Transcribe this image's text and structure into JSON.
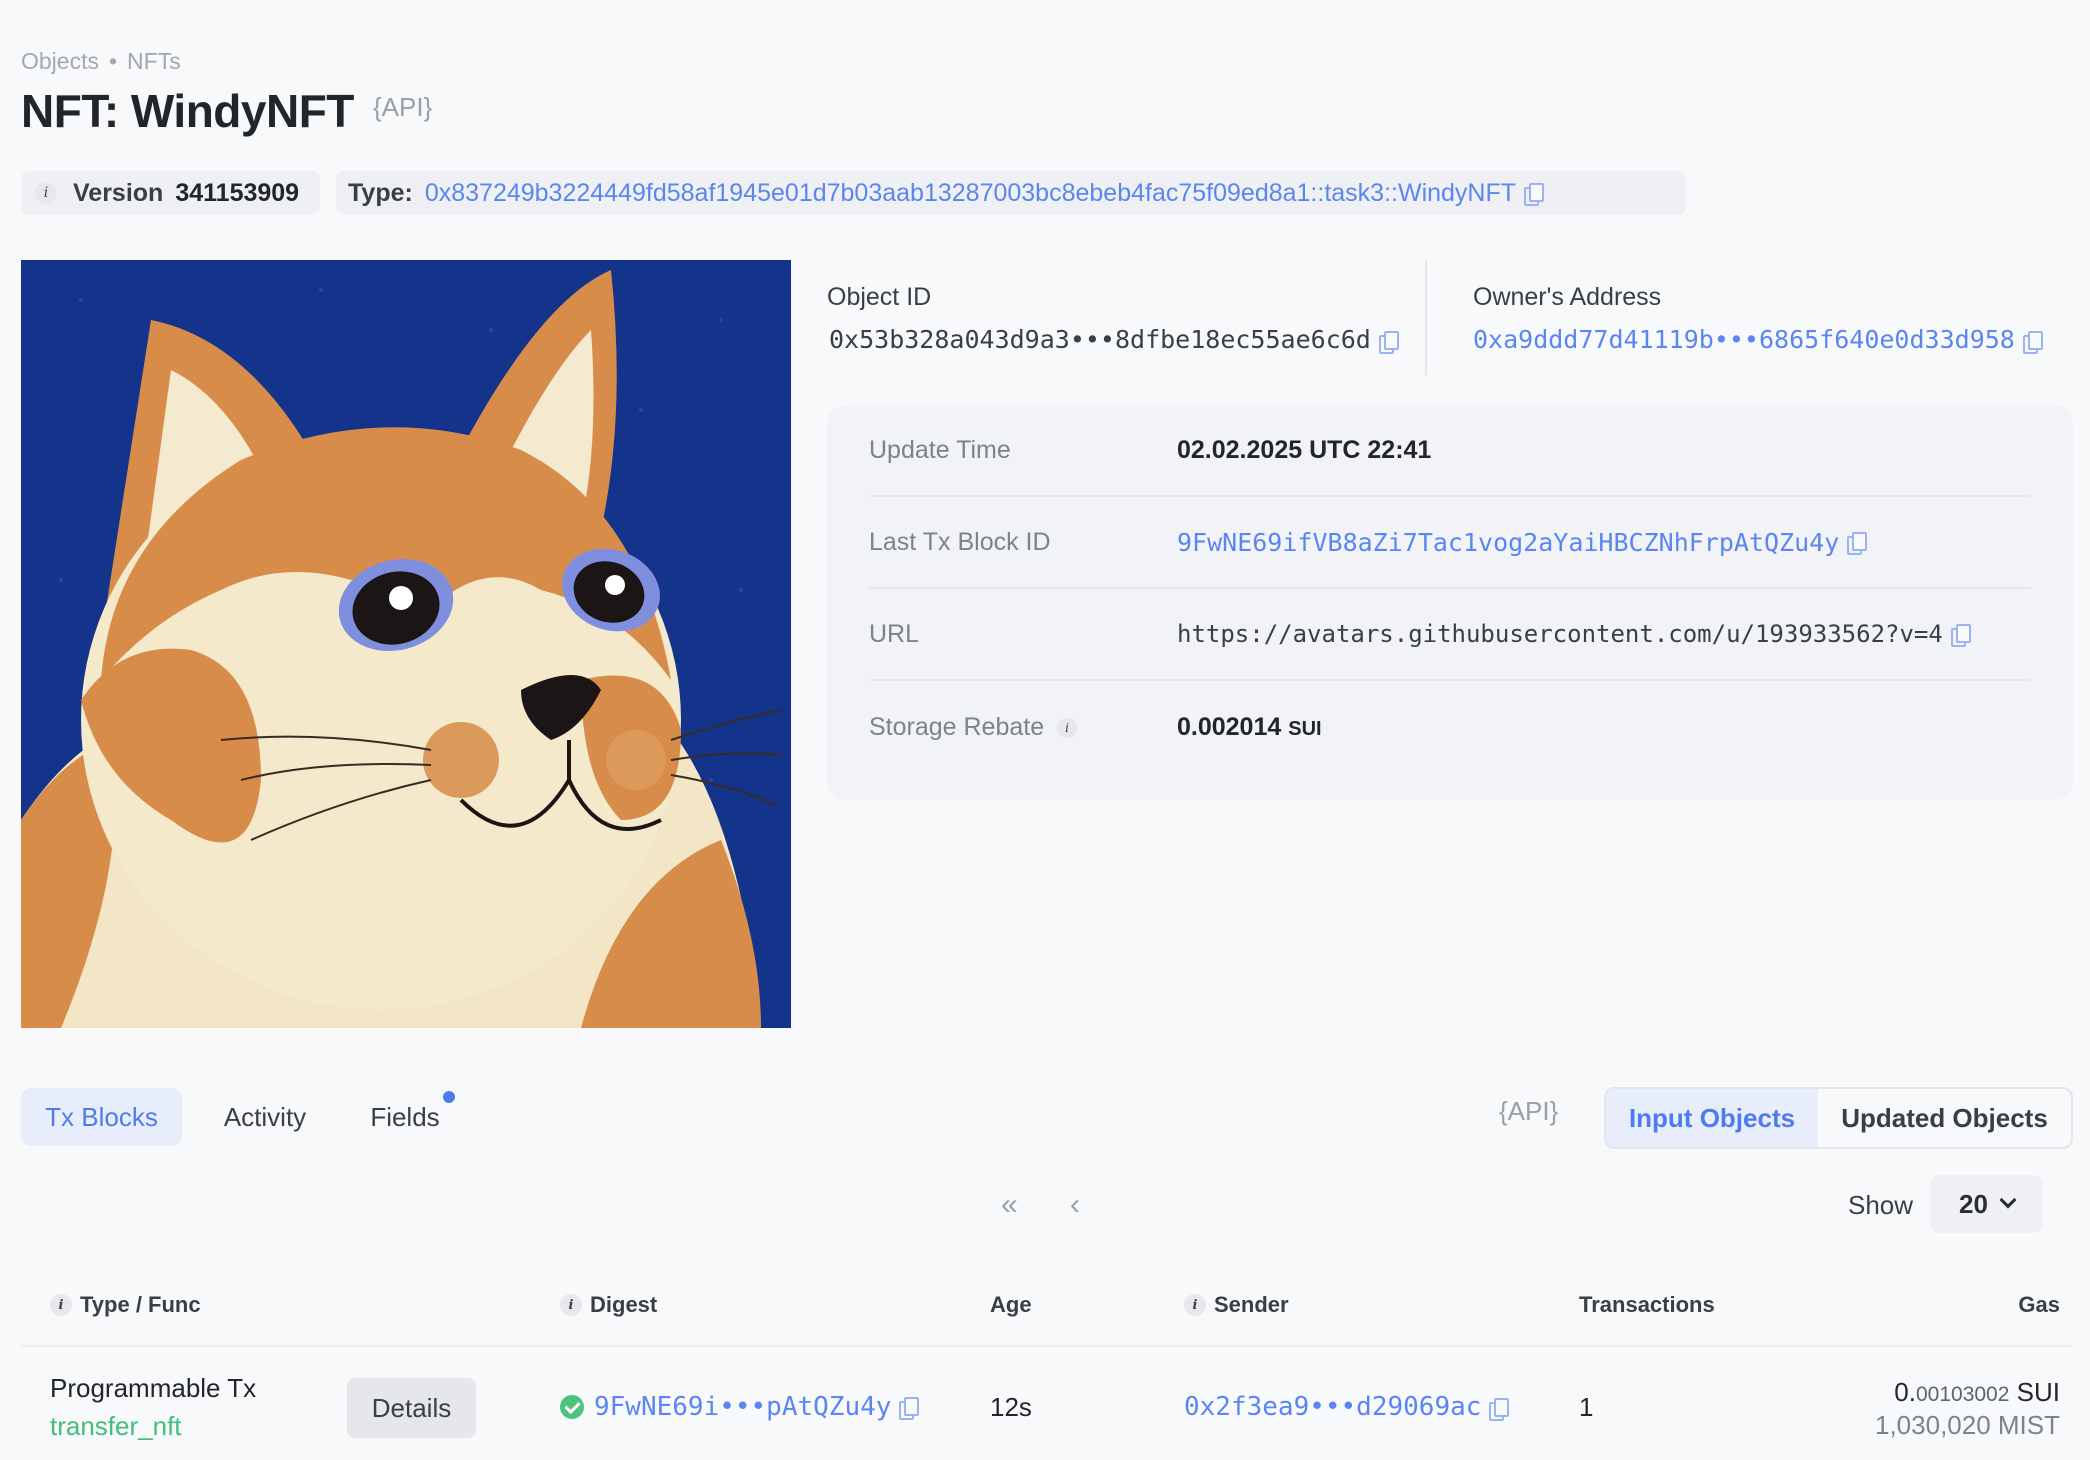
{
  "breadcrumb": {
    "items": [
      "Objects",
      "NFTs"
    ]
  },
  "page": {
    "title": "NFT: WindyNFT",
    "api_label": "{API}"
  },
  "version": {
    "label": "Version",
    "value": "341153909"
  },
  "type": {
    "label": "Type:",
    "value": "0x837249b3224449fd58af1945e01d7b03aab13287003bc8ebeb4fac75f09ed8a1::task3::WindyNFT"
  },
  "object": {
    "label": "Object ID",
    "value": "0x53b328a043d9a3•••8dfbe18ec55ae6c6d"
  },
  "owner": {
    "label": "Owner's Address",
    "value": "0xa9ddd77d41119b•••6865f640e0d33d958"
  },
  "details": {
    "update_time": {
      "label": "Update Time",
      "value": "02.02.2025 UTC 22:41"
    },
    "last_tx": {
      "label": "Last Tx Block ID",
      "value": "9FwNE69ifVB8aZi7Tac1vog2aYaiHBCZNhFrpAtQZu4y"
    },
    "url": {
      "label": "URL",
      "value": "https://avatars.githubusercontent.com/u/193933562?v=4"
    },
    "storage_rebate": {
      "label": "Storage Rebate",
      "value": "0.002014",
      "unit": "SUI"
    }
  },
  "tabs": {
    "tx_blocks": "Tx Blocks",
    "activity": "Activity",
    "fields": "Fields",
    "api_label": "{API}"
  },
  "segment": {
    "input": "Input Objects",
    "updated": "Updated Objects"
  },
  "pagination": {
    "first": "«",
    "prev": "‹",
    "show_label": "Show",
    "show_value": "20"
  },
  "table": {
    "headers": {
      "type_func": "Type / Func",
      "digest": "Digest",
      "age": "Age",
      "sender": "Sender",
      "transactions": "Transactions",
      "gas": "Gas"
    },
    "rows": [
      {
        "type": "Programmable Tx",
        "func": "transfer_nft",
        "details_label": "Details",
        "digest": "9FwNE69i•••pAtQZu4y",
        "age": "12s",
        "sender": "0x2f3ea9•••d29069ac",
        "transactions": "1",
        "gas_whole": "0.",
        "gas_fraction": "00103002",
        "gas_unit": "SUI",
        "gas_mist": "1,030,020 MIST"
      }
    ]
  },
  "colors": {
    "accent": "#4f7cec",
    "link": "#5b86f2",
    "success": "#3fbf7a",
    "image_bg": "#12338a"
  }
}
